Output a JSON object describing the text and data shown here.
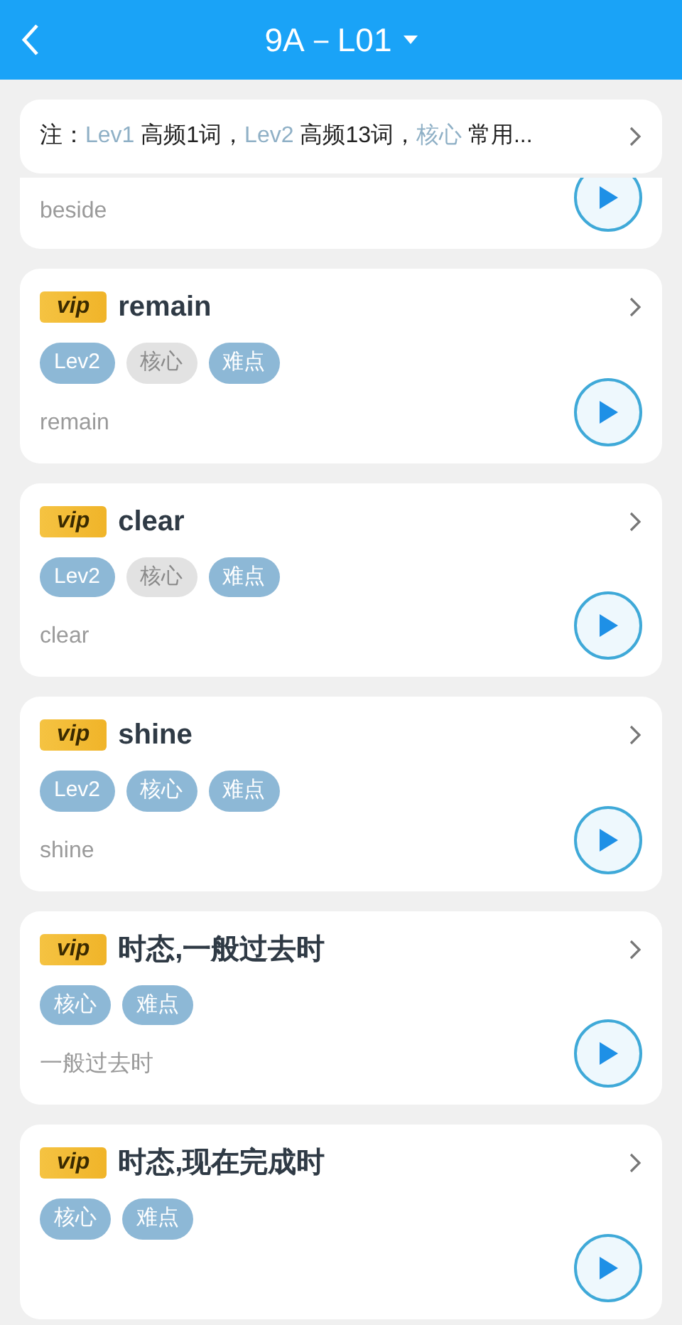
{
  "header": {
    "title": "9A－L01"
  },
  "note": {
    "segments": [
      {
        "text": "注：",
        "highlight": false
      },
      {
        "text": "Lev1",
        "highlight": true
      },
      {
        "text": " 高频1词，",
        "highlight": false
      },
      {
        "text": "Lev2",
        "highlight": true
      },
      {
        "text": " 高频13词，",
        "highlight": false
      },
      {
        "text": "核心",
        "highlight": true
      },
      {
        "text": " 常用...",
        "highlight": false
      }
    ]
  },
  "partial_card": {
    "subtitle": "beside"
  },
  "cards": [
    {
      "badge": "vip",
      "title": "remain",
      "tags": [
        {
          "label": "Lev2",
          "active": true
        },
        {
          "label": "核心",
          "active": false
        },
        {
          "label": "难点",
          "active": true
        }
      ],
      "subtitle": "remain"
    },
    {
      "badge": "vip",
      "title": "clear",
      "tags": [
        {
          "label": "Lev2",
          "active": true
        },
        {
          "label": "核心",
          "active": false
        },
        {
          "label": "难点",
          "active": true
        }
      ],
      "subtitle": "clear"
    },
    {
      "badge": "vip",
      "title": "shine",
      "tags": [
        {
          "label": "Lev2",
          "active": true
        },
        {
          "label": "核心",
          "active": true
        },
        {
          "label": "难点",
          "active": true
        }
      ],
      "subtitle": "shine"
    },
    {
      "badge": "vip",
      "title": "时态,一般过去时",
      "tags": [
        {
          "label": "核心",
          "active": true
        },
        {
          "label": "难点",
          "active": true
        }
      ],
      "subtitle": "一般过去时"
    },
    {
      "badge": "vip",
      "title": "时态,现在完成时",
      "tags": [
        {
          "label": "核心",
          "active": true
        },
        {
          "label": "难点",
          "active": true
        }
      ]
    }
  ]
}
